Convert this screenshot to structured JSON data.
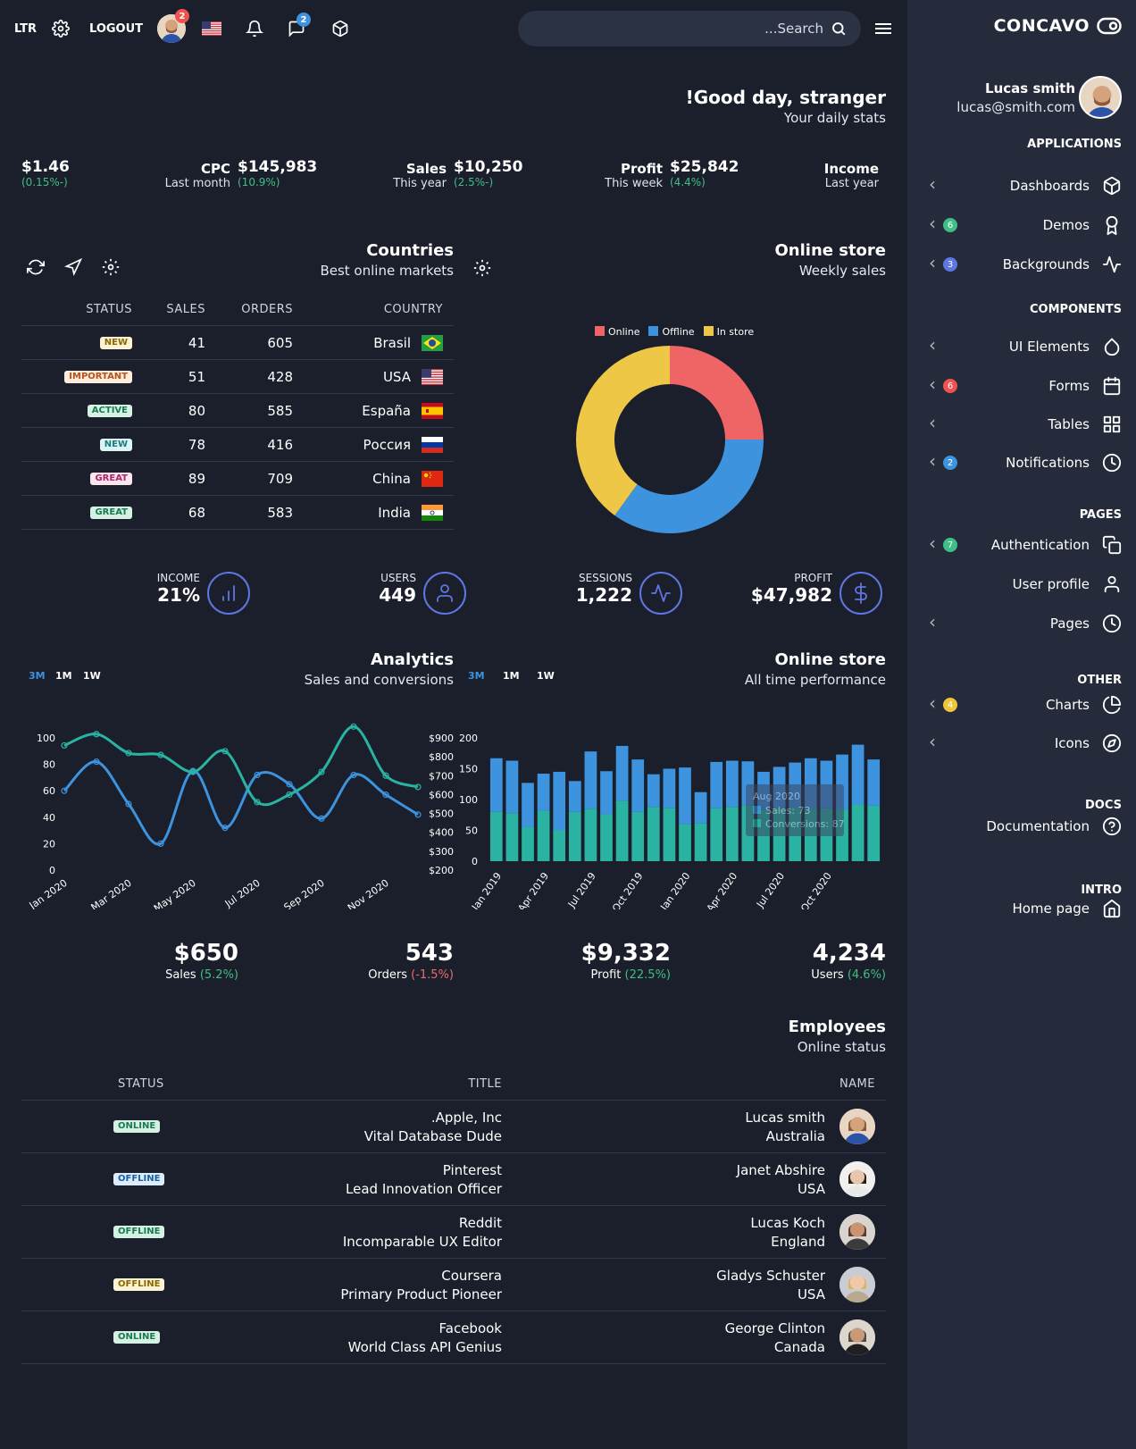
{
  "topbar": {
    "dir_label": "LTR",
    "logout_label": "LOGOUT",
    "avatar_badge": "2",
    "messages_badge": "2",
    "search_placeholder": "...Search"
  },
  "sidebar": {
    "brand": "CONCAVO",
    "user_name": "Lucas smith",
    "user_email": "lucas@smith.com",
    "sections": {
      "applications": "APPLICATIONS",
      "components": "COMPONENTS",
      "pages": "PAGES",
      "other": "OTHER",
      "docs": "DOCS",
      "intro": "INTRO"
    },
    "items": [
      {
        "label": "Dashboards",
        "count": "",
        "icon": "box-icon"
      },
      {
        "label": "Demos",
        "count": "6",
        "icon": "award-icon"
      },
      {
        "label": "Backgrounds",
        "count": "3",
        "icon": "activity-icon"
      },
      {
        "label": "UI Elements",
        "count": "",
        "icon": "droplet-icon"
      },
      {
        "label": "Forms",
        "count": "6",
        "icon": "calendar-icon"
      },
      {
        "label": "Tables",
        "count": "",
        "icon": "grid-icon"
      },
      {
        "label": "Notifications",
        "count": "2",
        "icon": "clock-icon"
      },
      {
        "label": "Authentication",
        "count": "7",
        "icon": "copy-icon"
      },
      {
        "label": "User profile",
        "count": "",
        "icon": "user-icon"
      },
      {
        "label": "Pages",
        "count": "",
        "icon": "clock-icon"
      },
      {
        "label": "Charts",
        "count": "4",
        "icon": "pie-chart-icon"
      },
      {
        "label": "Icons",
        "count": "",
        "icon": "compass-icon"
      },
      {
        "label": "Documentation",
        "count": "",
        "icon": "help-circle-icon"
      },
      {
        "label": "Home page",
        "count": "",
        "icon": "home-icon"
      }
    ],
    "colors": {
      "green": "#3fbf86",
      "purple": "#5e77e0",
      "red": "#ef5350",
      "blue": "#3d8fd6",
      "yellow": "#f0c43c"
    }
  },
  "greeting": {
    "title": "!Good day, stranger",
    "subtitle": "Your daily stats"
  },
  "daily_stats": [
    {
      "value": "$1.46",
      "change": "(0.15%-)",
      "label": "CPC",
      "period": "Last month"
    },
    {
      "value": "$145,983",
      "change": "(10.9%)",
      "label": "Sales",
      "period": "This year"
    },
    {
      "value": "$10,250",
      "change": "(2.5%-)",
      "label": "Profit",
      "period": "This week"
    },
    {
      "value": "$25,842",
      "change": "(4.4%)",
      "label": "Income",
      "period": "Last year"
    }
  ],
  "countries": {
    "title": "Countries",
    "subtitle": "Best online markets",
    "headers": {
      "status": "STATUS",
      "sales": "SALES",
      "orders": "ORDERS",
      "country": "COUNTRY"
    },
    "rows": [
      {
        "status": "NEW",
        "status_color": "#f0c43c",
        "sales": "41",
        "orders": "605",
        "country": "Brasil",
        "flag": "br"
      },
      {
        "status": "IMPORTANT",
        "status_color": "#f5a25d",
        "sales": "51",
        "orders": "428",
        "country": "USA",
        "flag": "us"
      },
      {
        "status": "ACTIVE",
        "status_color": "#3fbf86",
        "sales": "80",
        "orders": "585",
        "country": "España",
        "flag": "es"
      },
      {
        "status": "NEW",
        "status_color": "#5ad1d6",
        "sales": "78",
        "orders": "416",
        "country": "Россия",
        "flag": "ru"
      },
      {
        "status": "GREAT",
        "status_color": "#f287b6",
        "sales": "89",
        "orders": "709",
        "country": "China",
        "flag": "cn"
      },
      {
        "status": "GREAT",
        "status_color": "#3fbf86",
        "sales": "68",
        "orders": "583",
        "country": "India",
        "flag": "in"
      }
    ]
  },
  "online_store_weekly": {
    "title": "Online store",
    "subtitle": "Weekly sales"
  },
  "kpis": [
    {
      "label": "INCOME",
      "value": "21%",
      "icon": "bar-chart-icon"
    },
    {
      "label": "USERS",
      "value": "449",
      "icon": "user-icon"
    },
    {
      "label": "SESSIONS",
      "value": "1,222",
      "icon": "activity-icon"
    },
    {
      "label": "PROFIT",
      "value": "$47,982",
      "icon": "dollar-icon"
    }
  ],
  "analytics": {
    "title": "Analytics",
    "subtitle": "Sales and conversions",
    "ranges": [
      "3M",
      "1M",
      "1W"
    ]
  },
  "online_store_all": {
    "title": "Online store",
    "subtitle": "All time performance",
    "ranges": [
      "3M",
      "1M",
      "1W"
    ],
    "tooltip": {
      "title": "Aug 2020",
      "line1": "Sales: 73",
      "line2": "Conversions: 87"
    }
  },
  "summary": [
    {
      "value": "$650",
      "label": "Sales",
      "change": "(5.2%)",
      "trend": "up"
    },
    {
      "value": "543",
      "label": "Orders",
      "change": "(-1.5%)",
      "trend": "down"
    },
    {
      "value": "$9,332",
      "label": "Profit",
      "change": "(22.5%)",
      "trend": "up"
    },
    {
      "value": "4,234",
      "label": "Users",
      "change": "(4.6%)",
      "trend": "up"
    }
  ],
  "employees": {
    "title": "Employees",
    "subtitle": "Online status",
    "headers": {
      "status": "STATUS",
      "title": "TITLE",
      "name": "NAME"
    },
    "rows": [
      {
        "status": "ONLINE",
        "status_color": "#3fbf86",
        "company": ".Apple, Inc",
        "role": "Vital Database Dude",
        "name": "Lucas smith",
        "country": "Australia"
      },
      {
        "status": "OFFLINE",
        "status_color": "#5aa9f0",
        "company": "Pinterest",
        "role": "Lead Innovation Officer",
        "name": "Janet Abshire",
        "country": "USA"
      },
      {
        "status": "OFFLINE",
        "status_color": "#3fbf86",
        "company": "Reddit",
        "role": "Incomparable UX Editor",
        "name": "Lucas Koch",
        "country": "England"
      },
      {
        "status": "OFFLINE",
        "status_color": "#f0c43c",
        "company": "Coursera",
        "role": "Primary Product Pioneer",
        "name": "Gladys Schuster",
        "country": "USA"
      },
      {
        "status": "ONLINE",
        "status_color": "#3fbf86",
        "company": "Facebook",
        "role": "World Class API Genius",
        "name": "George Clinton",
        "country": "Canada"
      }
    ]
  },
  "chart_data": [
    {
      "type": "pie",
      "legend": [
        "Online",
        "Offline",
        "In store"
      ],
      "values": [
        25,
        35,
        40
      ],
      "colors": [
        "#ef6464",
        "#3d93dd",
        "#eec747"
      ],
      "legend_position": "top"
    },
    {
      "type": "line",
      "x": [
        "Jan 2020",
        "Feb 2020",
        "Mar 2020",
        "Apr 2020",
        "May 2020",
        "Jun 2020",
        "Jul 2020",
        "Aug 2020",
        "Sep 2020",
        "Oct 2020",
        "Nov 2020",
        "Dec 2020"
      ],
      "x_ticks": [
        "Jan 2020",
        "Mar 2020",
        "May 2020",
        "Jul 2020",
        "Sep 2020",
        "Nov 2020"
      ],
      "series": [
        {
          "axis": "left",
          "color": "#3d93dd",
          "values": [
            60,
            82,
            50,
            20,
            75,
            32,
            72,
            65,
            39,
            72,
            57,
            42
          ]
        },
        {
          "axis": "right",
          "color": "#2ab3a3",
          "values": [
            860,
            920,
            820,
            810,
            720,
            830,
            560,
            600,
            720,
            960,
            700,
            640
          ]
        }
      ],
      "yleft_ticks": [
        "0",
        "20",
        "40",
        "60",
        "80",
        "100"
      ],
      "yleft_lim": [
        0,
        100
      ],
      "yright_ticks": [
        "$200",
        "$300",
        "$400",
        "$500",
        "$600",
        "$700",
        "$800",
        "$900"
      ],
      "yright_lim": [
        200,
        900
      ]
    },
    {
      "type": "bar",
      "stacked": true,
      "x_ticks": [
        "Jan 2019",
        "Apr 2019",
        "Jul 2019",
        "Oct 2019",
        "Jan 2020",
        "Apr 2020",
        "Jul 2020",
        "Oct 2020"
      ],
      "categories": [
        "Jan 2019",
        "Feb 2019",
        "Mar 2019",
        "Apr 2019",
        "May 2019",
        "Jun 2019",
        "Jul 2019",
        "Aug 2019",
        "Sep 2019",
        "Oct 2019",
        "Nov 2019",
        "Dec 2019",
        "Jan 2020",
        "Feb 2020",
        "Mar 2020",
        "Apr 2020",
        "May 2020",
        "Jun 2020",
        "Jul 2020",
        "Aug 2020",
        "Sep 2020",
        "Oct 2020",
        "Nov 2020",
        "Dec 2020",
        "Jan 2021"
      ],
      "series": [
        {
          "color": "#2ab3a3",
          "values": [
            80,
            78,
            55,
            82,
            50,
            80,
            85,
            76,
            98,
            80,
            88,
            86,
            60,
            62,
            86,
            88,
            90,
            83,
            86,
            87,
            85,
            86,
            84,
            92,
            90
          ]
        },
        {
          "color": "#3d93dd",
          "values": [
            87,
            85,
            72,
            60,
            95,
            50,
            93,
            70,
            89,
            85,
            53,
            64,
            92,
            50,
            75,
            75,
            72,
            62,
            67,
            73,
            82,
            77,
            89,
            97,
            75
          ]
        }
      ],
      "y_ticks": [
        "0",
        "50",
        "100",
        "150",
        "200"
      ],
      "ylim": [
        0,
        200
      ]
    }
  ]
}
